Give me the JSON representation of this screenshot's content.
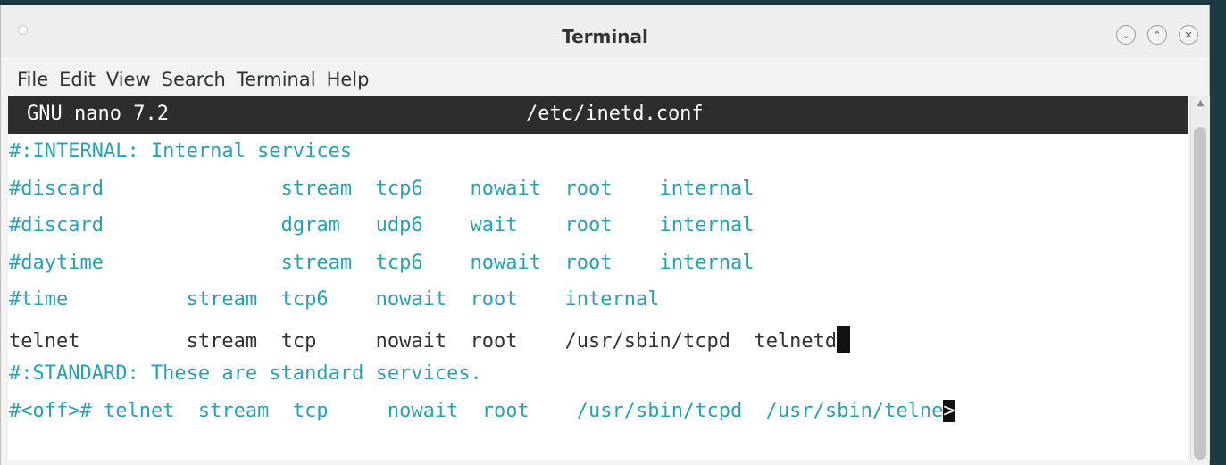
{
  "window": {
    "title": "Terminal",
    "buttons": [
      {
        "name": "minimize-button",
        "glyph": "⌄"
      },
      {
        "name": "maximize-button",
        "glyph": "⌃"
      },
      {
        "name": "close-button",
        "glyph": "✕"
      }
    ]
  },
  "menubar": {
    "items": [
      "File",
      "Edit",
      "View",
      "Search",
      "Terminal",
      "Help"
    ]
  },
  "nano": {
    "version": "GNU nano 7.2",
    "filename": "/etc/inetd.conf"
  },
  "editor": {
    "lines": [
      {
        "text": "#:INTERNAL: Internal services",
        "type": "comment"
      },
      {
        "text": "#discard               stream  tcp6    nowait  root    internal",
        "type": "comment"
      },
      {
        "text": "#discard               dgram   udp6    wait    root    internal",
        "type": "comment"
      },
      {
        "text": "#daytime               stream  tcp6    nowait  root    internal",
        "type": "comment"
      },
      {
        "text": "#time          stream  tcp6    nowait  root    internal",
        "type": "comment"
      },
      {
        "text": "telnet         stream  tcp     nowait  root    /usr/sbin/tcpd  telnetd",
        "type": "plain",
        "cursor_after": true
      },
      {
        "text": "#:STANDARD: These are standard services.",
        "type": "comment"
      },
      {
        "text": "#<off># telnet  stream  tcp     nowait  root    /usr/sbin/tcpd  /usr/sbin/telne",
        "type": "comment",
        "more_marker": ">"
      }
    ]
  },
  "colors": {
    "comment": "#2aa1b3",
    "plain": "#2e3436",
    "header_bg": "#2d2d2d",
    "desktop_bg": "#1b3a44"
  }
}
